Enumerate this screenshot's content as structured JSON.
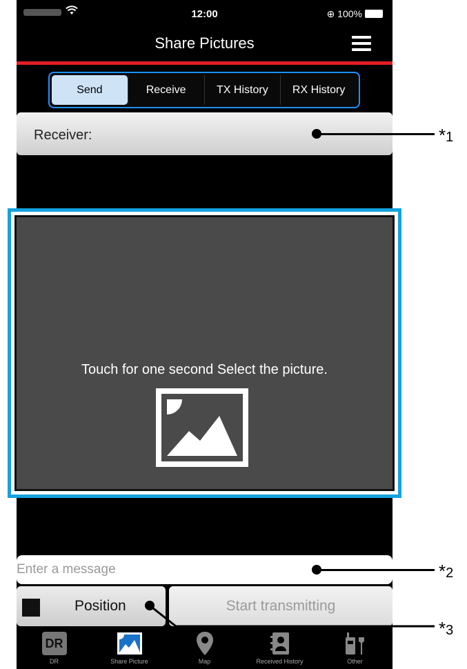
{
  "status_bar": {
    "time": "12:00",
    "battery": "⊕ 100%"
  },
  "header": {
    "title": "Share Pictures"
  },
  "tabs": [
    {
      "label": "Send",
      "active": true
    },
    {
      "label": "Receive",
      "active": false
    },
    {
      "label": "TX History",
      "active": false
    },
    {
      "label": "RX History",
      "active": false
    }
  ],
  "receiver": {
    "label": "Receiver:"
  },
  "picture": {
    "prompt": "Touch for one second Select the picture."
  },
  "message": {
    "placeholder": "Enter a message"
  },
  "buttons": {
    "position": "Position",
    "start": "Start transmitting"
  },
  "bottom_nav": [
    {
      "label": "DR",
      "icon": "dr-icon",
      "glyph": "DR"
    },
    {
      "label": "Share Picture",
      "icon": "picture-icon"
    },
    {
      "label": "Map",
      "icon": "map-pin-icon"
    },
    {
      "label": "Received History",
      "icon": "contact-book-icon"
    },
    {
      "label": "Other",
      "icon": "radio-wrench-icon"
    }
  ],
  "annotations": [
    {
      "star": "*",
      "num": "1"
    },
    {
      "star": "*",
      "num": "2"
    },
    {
      "star": "*",
      "num": "3"
    }
  ],
  "colors": {
    "accent_red": "#e31e24",
    "frame_blue": "#14a2de",
    "tab_border": "#1e90ff",
    "active_tab": "#cfe3f6"
  }
}
